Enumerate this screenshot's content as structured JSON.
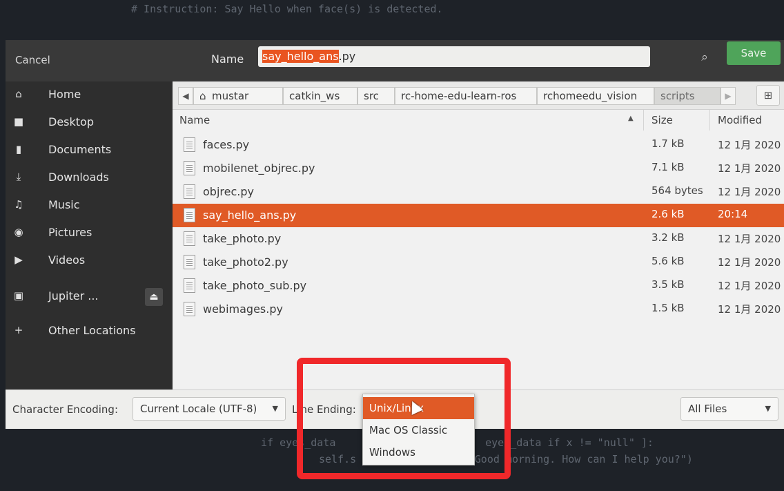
{
  "background_code": {
    "top_line": "# Instruction: Say Hello when face(s) is detected.",
    "line1": "if eyes_data                        eyes_data if x != \"null\" ]:",
    "line2": "self.s                 (\"Good morning. How can I help you?\")"
  },
  "header": {
    "cancel_label": "Cancel",
    "name_label": "Name",
    "filename_selected": "say_hello_ans",
    "filename_ext": ".py",
    "save_label": "Save"
  },
  "sidebar": {
    "items": [
      {
        "label": "Home",
        "icon": "home-icon"
      },
      {
        "label": "Desktop",
        "icon": "folder-icon"
      },
      {
        "label": "Documents",
        "icon": "document-icon"
      },
      {
        "label": "Downloads",
        "icon": "download-icon"
      },
      {
        "label": "Music",
        "icon": "music-icon"
      },
      {
        "label": "Pictures",
        "icon": "camera-icon"
      },
      {
        "label": "Videos",
        "icon": "video-icon"
      },
      {
        "label": "Jupiter ...",
        "icon": "drive-icon"
      },
      {
        "label": "Other Locations",
        "icon": "plus-icon"
      }
    ]
  },
  "pathbar": {
    "crumbs": [
      "mustar",
      "catkin_ws",
      "src",
      "rc-home-edu-learn-ros",
      "rchomeedu_vision",
      "scripts"
    ]
  },
  "columns": {
    "name": "Name",
    "size": "Size",
    "modified": "Modified"
  },
  "files": [
    {
      "name": "faces.py",
      "size": "1.7 kB",
      "modified": "12 1月 2020"
    },
    {
      "name": "mobilenet_objrec.py",
      "size": "7.1 kB",
      "modified": "12 1月 2020"
    },
    {
      "name": "objrec.py",
      "size": "564 bytes",
      "modified": "12 1月 2020"
    },
    {
      "name": "say_hello_ans.py",
      "size": "2.6 kB",
      "modified": "20:14",
      "selected": true
    },
    {
      "name": "take_photo.py",
      "size": "3.2 kB",
      "modified": "12 1月 2020"
    },
    {
      "name": "take_photo2.py",
      "size": "5.6 kB",
      "modified": "12 1月 2020"
    },
    {
      "name": "take_photo_sub.py",
      "size": "3.5 kB",
      "modified": "12 1月 2020"
    },
    {
      "name": "webimages.py",
      "size": "1.5 kB",
      "modified": "12 1月 2020"
    }
  ],
  "footer": {
    "encoding_label": "Character Encoding:",
    "encoding_value": "Current Locale (UTF-8)",
    "line_ending_label": "Line Ending:",
    "filter_value": "All Files"
  },
  "line_ending_menu": {
    "options": [
      "Unix/Linux",
      "Mac OS Classic",
      "Windows"
    ],
    "selected": "Unix/Linux"
  },
  "colors": {
    "accent": "#e05a26",
    "save": "#4fa45a",
    "annotation": "#f0282a"
  }
}
